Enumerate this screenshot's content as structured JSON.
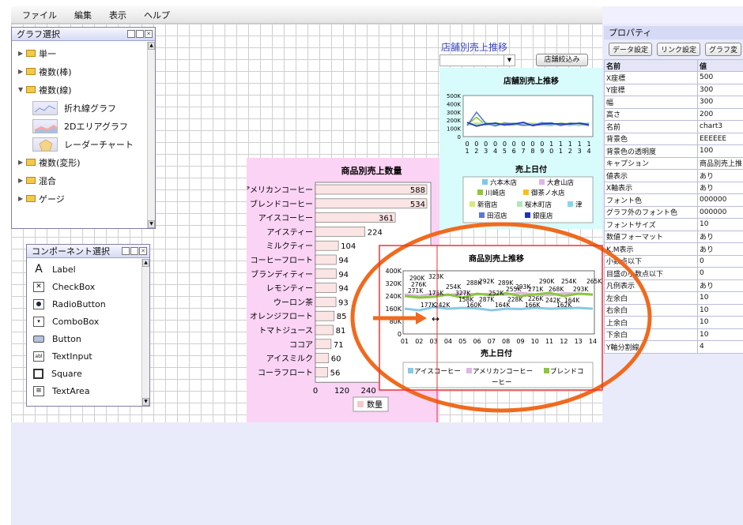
{
  "menu": [
    "ファイル",
    "編集",
    "表示",
    "ヘルプ"
  ],
  "graph_panel": {
    "title": "グラフ選択",
    "items": [
      {
        "label": "単一",
        "open": false
      },
      {
        "label": "複数(棒)",
        "open": false
      },
      {
        "label": "複数(線)",
        "open": true
      },
      {
        "label": "複数(変形)",
        "open": false
      },
      {
        "label": "混合",
        "open": false
      },
      {
        "label": "ゲージ",
        "open": false
      }
    ],
    "subitems": [
      "折れ線グラフ",
      "2Dエリアグラフ",
      "レーダーチャート"
    ]
  },
  "component_panel": {
    "title": "コンポーネント選択",
    "items": [
      {
        "label": "Label",
        "icon": "A"
      },
      {
        "label": "CheckBox",
        "icon": "☒"
      },
      {
        "label": "RadioButton",
        "icon": "◉"
      },
      {
        "label": "ComboBox",
        "icon": "▾"
      },
      {
        "label": "Button",
        "icon": ""
      },
      {
        "label": "TextInput",
        "icon": "abl"
      },
      {
        "label": "Square",
        "icon": "□"
      },
      {
        "label": "TextArea",
        "icon": "≡"
      }
    ]
  },
  "store_title": "店舗別売上推移",
  "filter_button": "店舗絞込み",
  "bar_chart": {
    "title": "商品別売上数量",
    "categories": [
      "アメリカンコーヒー",
      "ブレンドコーヒー",
      "アイスコーヒー",
      "アイスティー",
      "ミルクティー",
      "コーヒーフロート",
      "ブランディティー",
      "レモンティー",
      "ウーロン茶",
      "オレンジフロート",
      "トマトジュース",
      "ココア",
      "アイスミルク",
      "コーラフロート"
    ],
    "values": [
      588,
      534,
      361,
      224,
      104,
      94,
      94,
      94,
      93,
      85,
      81,
      71,
      60,
      56
    ],
    "ticks": [
      "0",
      "120",
      "240"
    ],
    "legend": "数量"
  },
  "store_chart": {
    "title": "店舗別売上推移",
    "yticks": [
      "500K",
      "400K",
      "300K",
      "200K",
      "100K",
      "0"
    ],
    "xticks_top": [
      "0",
      "0",
      "0",
      "0",
      "0",
      "0",
      "0",
      "0",
      "0",
      "1",
      "1",
      "1",
      "1",
      "1"
    ],
    "xticks_bottom": [
      "1",
      "2",
      "3",
      "4",
      "5",
      "6",
      "7",
      "8",
      "9",
      "0",
      "1",
      "2",
      "3",
      "4"
    ],
    "xlabel": "売上日付",
    "legend": [
      {
        "name": "六本木店",
        "color": "#7ec8e8"
      },
      {
        "name": "大倉山店",
        "color": "#e0b4e6"
      },
      {
        "name": "川崎店",
        "color": "#8cc640"
      },
      {
        "name": "御茶ノ水店",
        "color": "#f6c21a"
      },
      {
        "name": "新宿店",
        "color": "#d8e87a"
      },
      {
        "name": "桜木町店",
        "color": "#b0e6b8"
      },
      {
        "name": "津",
        "color": "#86d6f0"
      },
      {
        "name": "田沼店",
        "color": "#5a78d8"
      },
      {
        "name": "銀座店",
        "color": "#2030c0"
      }
    ]
  },
  "line_chart": {
    "title": "商品別売上推移",
    "yticks": [
      "400K",
      "320K",
      "240K",
      "160K",
      "80K",
      "0"
    ],
    "xticks": [
      "01",
      "02",
      "03",
      "04",
      "05",
      "06",
      "07",
      "08",
      "09",
      "10",
      "11",
      "12",
      "13",
      "14"
    ],
    "xlabel": "売上日付",
    "labels": [
      "290K",
      "323K",
      "254K",
      "288K",
      "292K",
      "289K",
      "293K",
      "290K",
      "254K",
      "265K",
      "276K",
      "327K",
      "252K",
      "255K",
      "271K",
      "268K",
      "293K",
      "271K",
      "175K",
      "158K",
      "287K",
      "228K",
      "226K",
      "242K",
      "164K",
      "177K",
      "242K",
      "160K",
      "164K",
      "166K",
      "162K"
    ],
    "legend": [
      {
        "name": "アイスコーヒー",
        "color": "#88c9e6"
      },
      {
        "name": "アメリカンコーヒー",
        "color": "#e0b4e6"
      },
      {
        "name": "ブレンドコ",
        "color": "#8cc640"
      }
    ],
    "legend_wrap": "ーヒー"
  },
  "props": {
    "title": "プロパティ",
    "tabs": [
      "データ設定",
      "リンク設定",
      "グラフ変"
    ],
    "headers": [
      "名前",
      "値"
    ],
    "rows": [
      [
        "X座標",
        "500"
      ],
      [
        "Y座標",
        "300"
      ],
      [
        "幅",
        "300"
      ],
      [
        "高さ",
        "200"
      ],
      [
        "名前",
        "chart3"
      ],
      [
        "背景色",
        "EEEEEE"
      ],
      [
        "背景色の透明度",
        "100"
      ],
      [
        "キャプション",
        "商品別売上推"
      ],
      [
        "値表示",
        "あり"
      ],
      [
        "X軸表示",
        "あり"
      ],
      [
        "フォント色",
        "000000"
      ],
      [
        "グラフ外のフォント色",
        "000000"
      ],
      [
        "フォントサイズ",
        "10"
      ],
      [
        "数値フォーマット",
        "あり"
      ],
      [
        "K,M表示",
        "あり"
      ],
      [
        "小数点以下",
        "0"
      ],
      [
        "目盛の小数点以下",
        "0"
      ],
      [
        "凡例表示",
        "あり"
      ],
      [
        "左余白",
        "10"
      ],
      [
        "右余白",
        "10"
      ],
      [
        "上余白",
        "10"
      ],
      [
        "下余白",
        "10"
      ],
      [
        "Y軸分割線",
        "4"
      ]
    ]
  },
  "highlight_color": "#f06a1e"
}
